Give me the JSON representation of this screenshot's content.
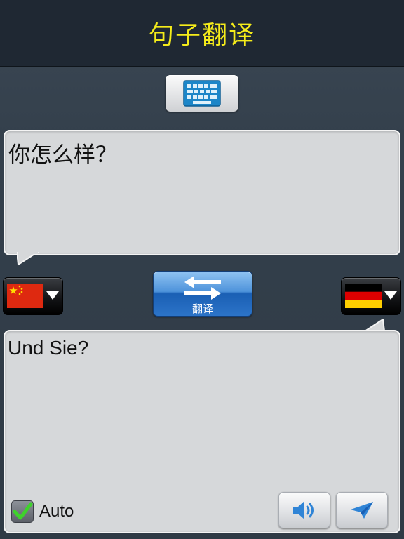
{
  "header": {
    "title": "句子翻译"
  },
  "input": {
    "text": "你怎么样？"
  },
  "output": {
    "text": "Und Sie?"
  },
  "translate_button": {
    "label": "翻译"
  },
  "source_language": {
    "flag": "china-flag"
  },
  "target_language": {
    "flag": "germany-flag"
  },
  "auto_option": {
    "label": "Auto",
    "checked": true
  },
  "icons": {
    "keyboard": "keyboard-icon",
    "swap": "swap-arrows-icon",
    "speaker": "speaker-icon",
    "send": "send-icon"
  },
  "colors": {
    "header_bg": "#1f2833",
    "title": "#f5ec1a",
    "accent_blue": "#2c74c8",
    "bubble_bg": "#d6d8da"
  }
}
